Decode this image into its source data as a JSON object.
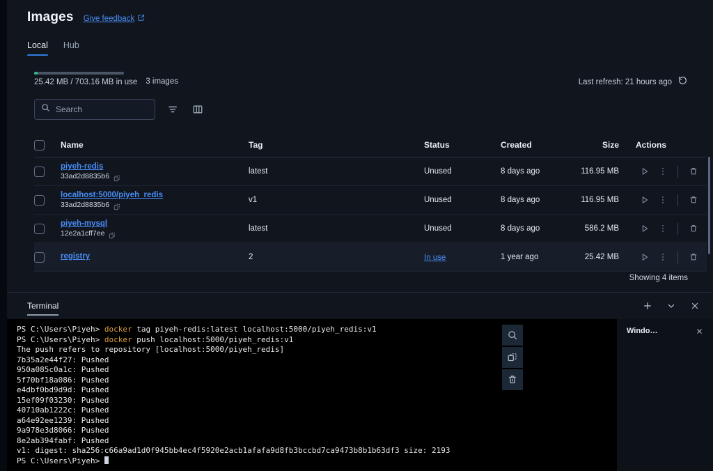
{
  "header": {
    "title": "Images",
    "feedback_label": "Give feedback",
    "feedback_icon": "external-link-icon"
  },
  "tabs": [
    {
      "label": "Local",
      "active": true
    },
    {
      "label": "Hub",
      "active": false
    }
  ],
  "storage": {
    "usage_text": "25.42 MB / 703.16 MB in use",
    "images_count": "3 images",
    "used_mb": 25.42,
    "total_mb": 703.16,
    "fill_color": "#2cbf8c",
    "track_color": "#4a5665"
  },
  "refresh": {
    "label": "Last refresh: 21 hours ago",
    "icon": "refresh-icon"
  },
  "toolbar": {
    "search_placeholder": "Search",
    "search_value": "",
    "search_icon": "search-icon",
    "filter_icon": "filter-icon",
    "columns_icon": "columns-icon"
  },
  "table": {
    "columns": [
      "Name",
      "Tag",
      "Status",
      "Created",
      "Size",
      "Actions"
    ],
    "rows": [
      {
        "name": "piyeh-redis",
        "image_id": "33ad2d8835b6",
        "tag": "latest",
        "status": "Unused",
        "status_is_link": false,
        "created": "8 days ago",
        "size": "116.95 MB",
        "highlight": false
      },
      {
        "name": "localhost:5000/piyeh_redis",
        "image_id": "33ad2d8835b6",
        "tag": "v1",
        "status": "Unused",
        "status_is_link": false,
        "created": "8 days ago",
        "size": "116.95 MB",
        "highlight": false
      },
      {
        "name": "piyeh-mysql",
        "image_id": "12e2a1cff7ee",
        "tag": "latest",
        "status": "Unused",
        "status_is_link": false,
        "created": "8 days ago",
        "size": "586.2 MB",
        "highlight": false
      },
      {
        "name": "registry",
        "image_id": "",
        "tag": "2",
        "status": "In use",
        "status_is_link": true,
        "created": "1 year ago",
        "size": "25.42 MB",
        "highlight": true
      }
    ],
    "row_actions": {
      "run_icon": "play-icon",
      "menu_icon": "kebab-menu-icon",
      "delete_icon": "trash-icon"
    },
    "footer": "Showing 4 items"
  },
  "terminal": {
    "tab_label": "Terminal",
    "add_icon": "plus-icon",
    "chevron_icon": "chevron-down-icon",
    "close_icon": "close-icon",
    "side_tools": [
      {
        "icon": "search-icon"
      },
      {
        "icon": "copy-icon"
      },
      {
        "icon": "trash-icon"
      }
    ],
    "window_panel": {
      "title": "Windo…",
      "close_icon": "close-icon"
    },
    "lines": [
      {
        "prompt": "PS C:\\Users\\Piyeh> ",
        "keyword": "docker",
        "rest": " tag piyeh-redis:latest localhost:5000/piyeh_redis:v1"
      },
      {
        "prompt": "PS C:\\Users\\Piyeh> ",
        "keyword": "docker",
        "rest": " push localhost:5000/piyeh_redis:v1"
      },
      {
        "prompt": "",
        "keyword": "",
        "rest": "The push refers to repository [localhost:5000/piyeh_redis]"
      },
      {
        "prompt": "",
        "keyword": "",
        "rest": "7b35a2e44f27: Pushed"
      },
      {
        "prompt": "",
        "keyword": "",
        "rest": "950a085c0a1c: Pushed"
      },
      {
        "prompt": "",
        "keyword": "",
        "rest": "5f70bf18a086: Pushed"
      },
      {
        "prompt": "",
        "keyword": "",
        "rest": "e4dbf0bd9d9d: Pushed"
      },
      {
        "prompt": "",
        "keyword": "",
        "rest": "15ef09f03230: Pushed"
      },
      {
        "prompt": "",
        "keyword": "",
        "rest": "40710ab1222c: Pushed"
      },
      {
        "prompt": "",
        "keyword": "",
        "rest": "a64e92ee1239: Pushed"
      },
      {
        "prompt": "",
        "keyword": "",
        "rest": "9a978e3d8066: Pushed"
      },
      {
        "prompt": "",
        "keyword": "",
        "rest": "8e2ab394fabf: Pushed"
      },
      {
        "prompt": "",
        "keyword": "",
        "rest": "v1: digest: sha256:c66a9ad1d0f945bb4ec4f5920e2acb1afafa9d8fb3bccbd7ca9473b8b1b63df3 size: 2193"
      },
      {
        "prompt": "PS C:\\Users\\Piyeh> ",
        "keyword": "",
        "rest": "",
        "cursor": true
      }
    ]
  },
  "colors": {
    "accent": "#2f7de1",
    "link": "#4a8df5",
    "background": "#10151e",
    "terminal_bg": "#000000",
    "keyword": "#d79d3f",
    "storage_fill": "#2cbf8c"
  }
}
